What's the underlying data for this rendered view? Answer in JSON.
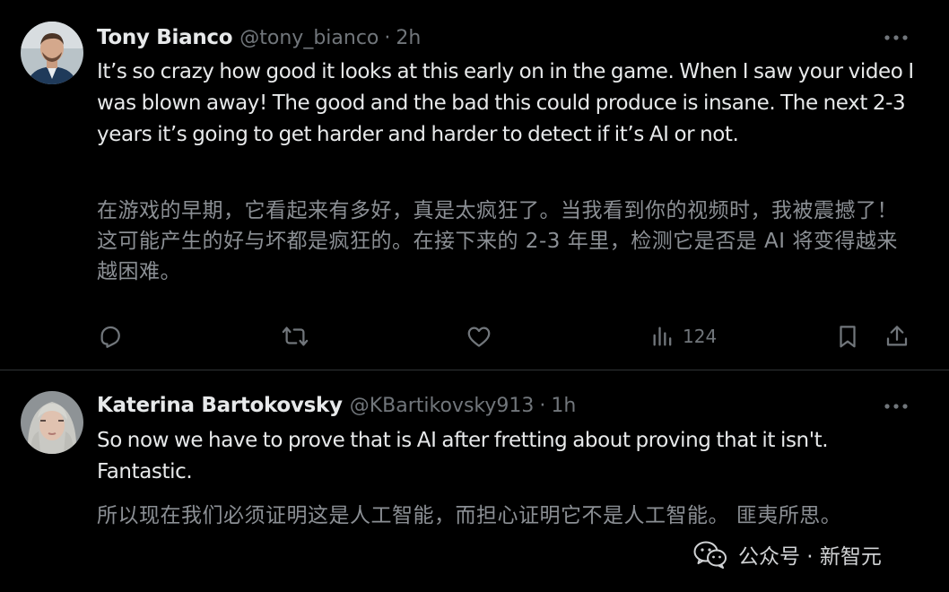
{
  "tweets": [
    {
      "display_name": "Tony Bianco",
      "handle": "@tony_bianco",
      "separator": "·",
      "time": "2h",
      "text_en": "It’s so crazy how good it looks at this early on in the game. When I saw your video I was blown away! The good and the bad this could produce is insane. The next 2-3 years it’s going to get harder and harder to detect if it’s AI or not.",
      "text_zh": "在游戏的早期，它看起来有多好，真是太疯狂了。当我看到你的视频时，我被震撼了！这可能产生的好与坏都是疯狂的。在接下来的 2-3 年里，检测它是否是 AI 将变得越来越困难。",
      "actions": {
        "reply_icon": "reply-icon",
        "retweet_icon": "retweet-icon",
        "like_icon": "heart-icon",
        "views_icon": "bar-chart-icon",
        "views_count": "124",
        "bookmark_icon": "bookmark-icon",
        "share_icon": "share-icon"
      }
    },
    {
      "display_name": "Katerina Bartokovsky",
      "handle": "@KBartikovsky913",
      "separator": "·",
      "time": "1h",
      "text_en": "So now we have to prove that is AI after fretting about proving that it isn't. Fantastic.",
      "text_zh": "所以现在我们必须证明这是人工智能，而担心证明它不是人工智能。 匪夷所思。"
    }
  ],
  "watermark": {
    "icon": "wechat-icon",
    "text": "公众号 · 新智元"
  },
  "colors": {
    "background": "#000000",
    "text_primary": "#e7e9ea",
    "text_secondary": "#71767b",
    "divider": "#2f3336"
  }
}
